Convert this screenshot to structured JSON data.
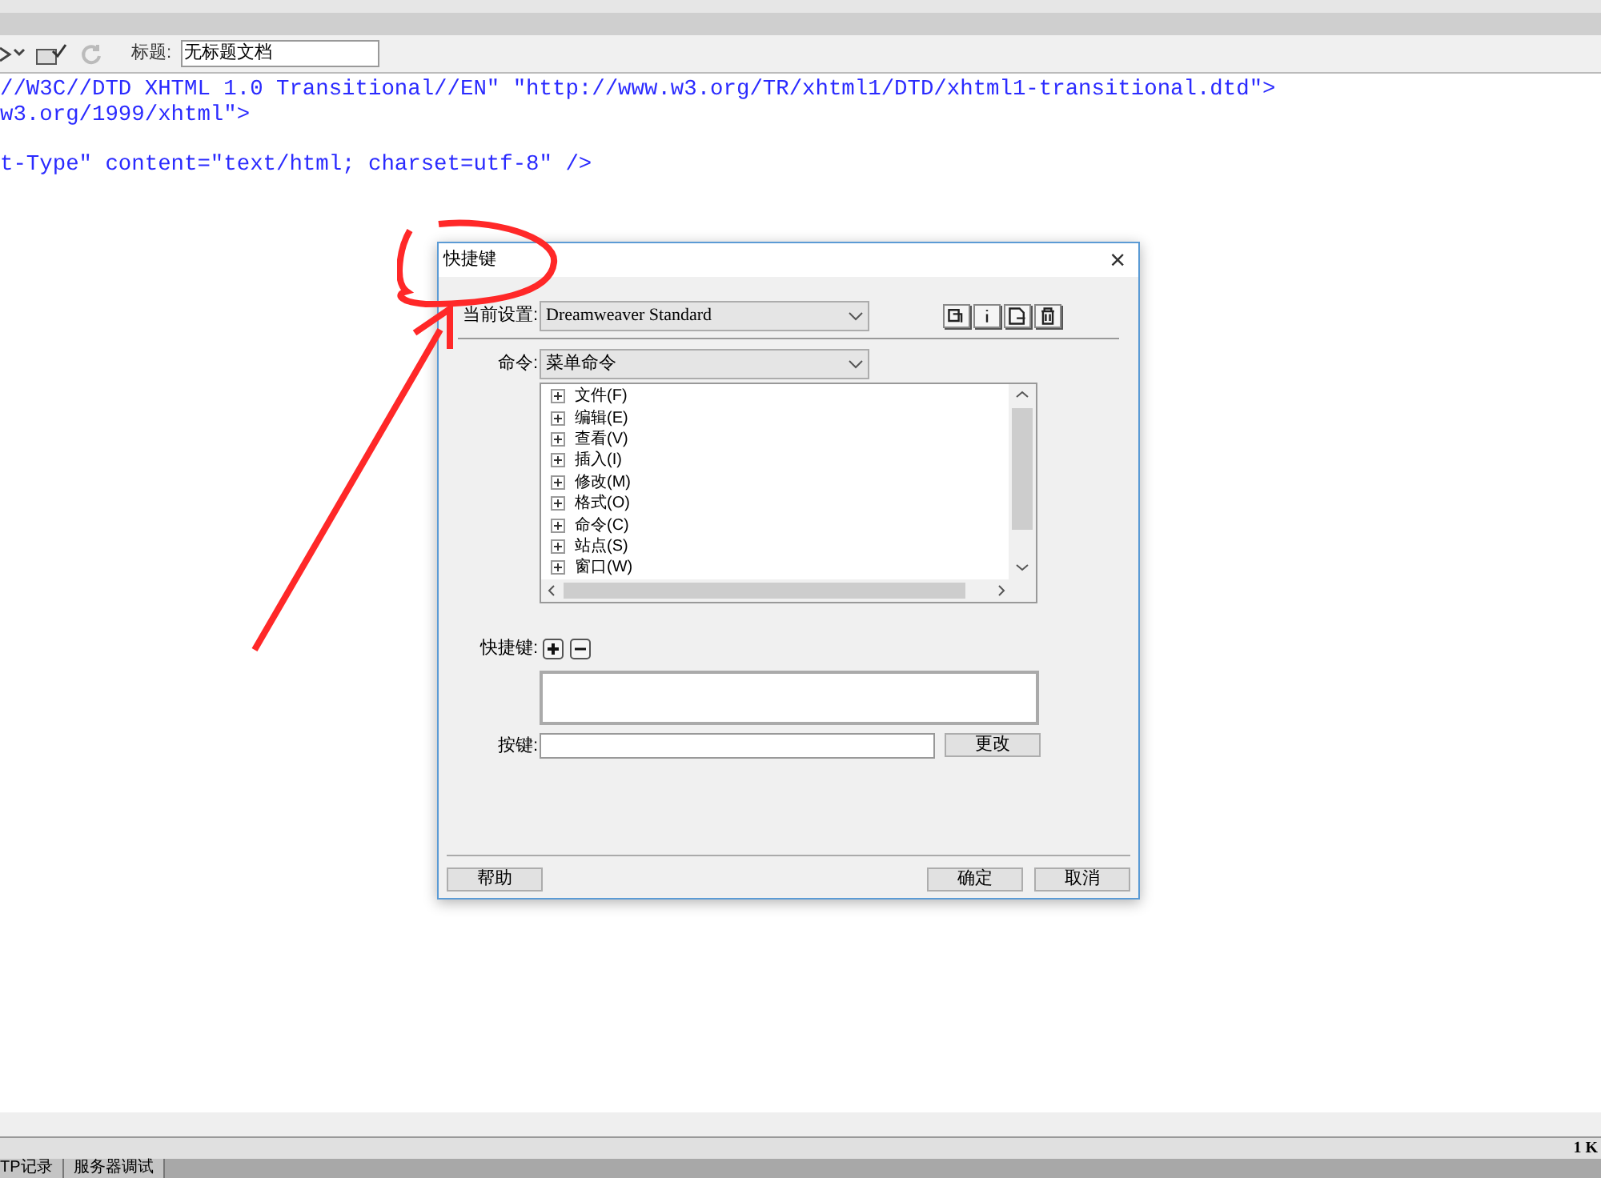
{
  "toolbar": {
    "title_label": "标题:",
    "title_value": "无标题文档"
  },
  "code_lines": [
    "//W3C//DTD XHTML 1.0 Transitional//EN\" \"http://www.w3.org/TR/xhtml1/DTD/xhtml1-transitional.dtd\">",
    "w3.org/1999/xhtml\">",
    "t-Type\" content=\"text/html; charset=utf-8\" />"
  ],
  "dialog": {
    "title": "快捷键",
    "close": "×",
    "current_set": {
      "label": "当前设置:",
      "value": "Dreamweaver Standard"
    },
    "command": {
      "label": "命令:",
      "value": "菜单命令"
    },
    "tree": [
      {
        "label": "文件(F)",
        "expanded": false
      },
      {
        "label": "编辑(E)",
        "expanded": false
      },
      {
        "label": "查看(V)",
        "expanded": false
      },
      {
        "label": "插入(I)",
        "expanded": false
      },
      {
        "label": "修改(M)",
        "expanded": false
      },
      {
        "label": "格式(O)",
        "expanded": false
      },
      {
        "label": "命令(C)",
        "expanded": false
      },
      {
        "label": "站点(S)",
        "expanded": false
      },
      {
        "label": "窗口(W)",
        "expanded": false
      }
    ],
    "shortcut_label": "快捷键:",
    "key_label": "按键:",
    "change_button": "更改",
    "help_button": "帮助",
    "ok_button": "确定",
    "cancel_button": "取消"
  },
  "status_bar": {
    "size": "1 K"
  },
  "panel_tabs": [
    {
      "label": "TP记录",
      "selected": false
    },
    {
      "label": "服务器调试",
      "selected": false
    }
  ]
}
